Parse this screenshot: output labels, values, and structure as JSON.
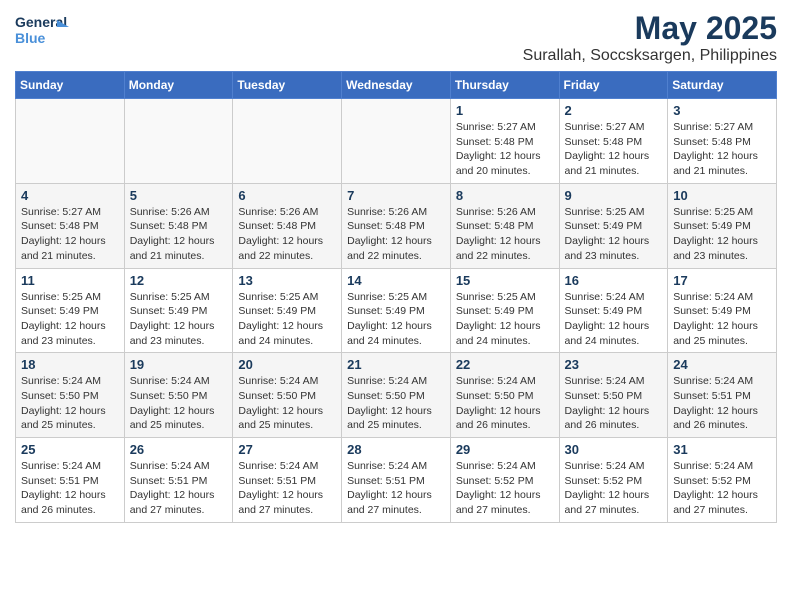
{
  "logo": {
    "line1": "General",
    "line2": "Blue"
  },
  "title": "May 2025",
  "subtitle": "Surallah, Soccsksargen, Philippines",
  "days": [
    "Sunday",
    "Monday",
    "Tuesday",
    "Wednesday",
    "Thursday",
    "Friday",
    "Saturday"
  ],
  "weeks": [
    [
      {
        "date": "",
        "info": ""
      },
      {
        "date": "",
        "info": ""
      },
      {
        "date": "",
        "info": ""
      },
      {
        "date": "",
        "info": ""
      },
      {
        "date": "1",
        "info": "Sunrise: 5:27 AM\nSunset: 5:48 PM\nDaylight: 12 hours\nand 20 minutes."
      },
      {
        "date": "2",
        "info": "Sunrise: 5:27 AM\nSunset: 5:48 PM\nDaylight: 12 hours\nand 21 minutes."
      },
      {
        "date": "3",
        "info": "Sunrise: 5:27 AM\nSunset: 5:48 PM\nDaylight: 12 hours\nand 21 minutes."
      }
    ],
    [
      {
        "date": "4",
        "info": "Sunrise: 5:27 AM\nSunset: 5:48 PM\nDaylight: 12 hours\nand 21 minutes."
      },
      {
        "date": "5",
        "info": "Sunrise: 5:26 AM\nSunset: 5:48 PM\nDaylight: 12 hours\nand 21 minutes."
      },
      {
        "date": "6",
        "info": "Sunrise: 5:26 AM\nSunset: 5:48 PM\nDaylight: 12 hours\nand 22 minutes."
      },
      {
        "date": "7",
        "info": "Sunrise: 5:26 AM\nSunset: 5:48 PM\nDaylight: 12 hours\nand 22 minutes."
      },
      {
        "date": "8",
        "info": "Sunrise: 5:26 AM\nSunset: 5:48 PM\nDaylight: 12 hours\nand 22 minutes."
      },
      {
        "date": "9",
        "info": "Sunrise: 5:25 AM\nSunset: 5:49 PM\nDaylight: 12 hours\nand 23 minutes."
      },
      {
        "date": "10",
        "info": "Sunrise: 5:25 AM\nSunset: 5:49 PM\nDaylight: 12 hours\nand 23 minutes."
      }
    ],
    [
      {
        "date": "11",
        "info": "Sunrise: 5:25 AM\nSunset: 5:49 PM\nDaylight: 12 hours\nand 23 minutes."
      },
      {
        "date": "12",
        "info": "Sunrise: 5:25 AM\nSunset: 5:49 PM\nDaylight: 12 hours\nand 23 minutes."
      },
      {
        "date": "13",
        "info": "Sunrise: 5:25 AM\nSunset: 5:49 PM\nDaylight: 12 hours\nand 24 minutes."
      },
      {
        "date": "14",
        "info": "Sunrise: 5:25 AM\nSunset: 5:49 PM\nDaylight: 12 hours\nand 24 minutes."
      },
      {
        "date": "15",
        "info": "Sunrise: 5:25 AM\nSunset: 5:49 PM\nDaylight: 12 hours\nand 24 minutes."
      },
      {
        "date": "16",
        "info": "Sunrise: 5:24 AM\nSunset: 5:49 PM\nDaylight: 12 hours\nand 24 minutes."
      },
      {
        "date": "17",
        "info": "Sunrise: 5:24 AM\nSunset: 5:49 PM\nDaylight: 12 hours\nand 25 minutes."
      }
    ],
    [
      {
        "date": "18",
        "info": "Sunrise: 5:24 AM\nSunset: 5:50 PM\nDaylight: 12 hours\nand 25 minutes."
      },
      {
        "date": "19",
        "info": "Sunrise: 5:24 AM\nSunset: 5:50 PM\nDaylight: 12 hours\nand 25 minutes."
      },
      {
        "date": "20",
        "info": "Sunrise: 5:24 AM\nSunset: 5:50 PM\nDaylight: 12 hours\nand 25 minutes."
      },
      {
        "date": "21",
        "info": "Sunrise: 5:24 AM\nSunset: 5:50 PM\nDaylight: 12 hours\nand 25 minutes."
      },
      {
        "date": "22",
        "info": "Sunrise: 5:24 AM\nSunset: 5:50 PM\nDaylight: 12 hours\nand 26 minutes."
      },
      {
        "date": "23",
        "info": "Sunrise: 5:24 AM\nSunset: 5:50 PM\nDaylight: 12 hours\nand 26 minutes."
      },
      {
        "date": "24",
        "info": "Sunrise: 5:24 AM\nSunset: 5:51 PM\nDaylight: 12 hours\nand 26 minutes."
      }
    ],
    [
      {
        "date": "25",
        "info": "Sunrise: 5:24 AM\nSunset: 5:51 PM\nDaylight: 12 hours\nand 26 minutes."
      },
      {
        "date": "26",
        "info": "Sunrise: 5:24 AM\nSunset: 5:51 PM\nDaylight: 12 hours\nand 27 minutes."
      },
      {
        "date": "27",
        "info": "Sunrise: 5:24 AM\nSunset: 5:51 PM\nDaylight: 12 hours\nand 27 minutes."
      },
      {
        "date": "28",
        "info": "Sunrise: 5:24 AM\nSunset: 5:51 PM\nDaylight: 12 hours\nand 27 minutes."
      },
      {
        "date": "29",
        "info": "Sunrise: 5:24 AM\nSunset: 5:52 PM\nDaylight: 12 hours\nand 27 minutes."
      },
      {
        "date": "30",
        "info": "Sunrise: 5:24 AM\nSunset: 5:52 PM\nDaylight: 12 hours\nand 27 minutes."
      },
      {
        "date": "31",
        "info": "Sunrise: 5:24 AM\nSunset: 5:52 PM\nDaylight: 12 hours\nand 27 minutes."
      }
    ]
  ]
}
